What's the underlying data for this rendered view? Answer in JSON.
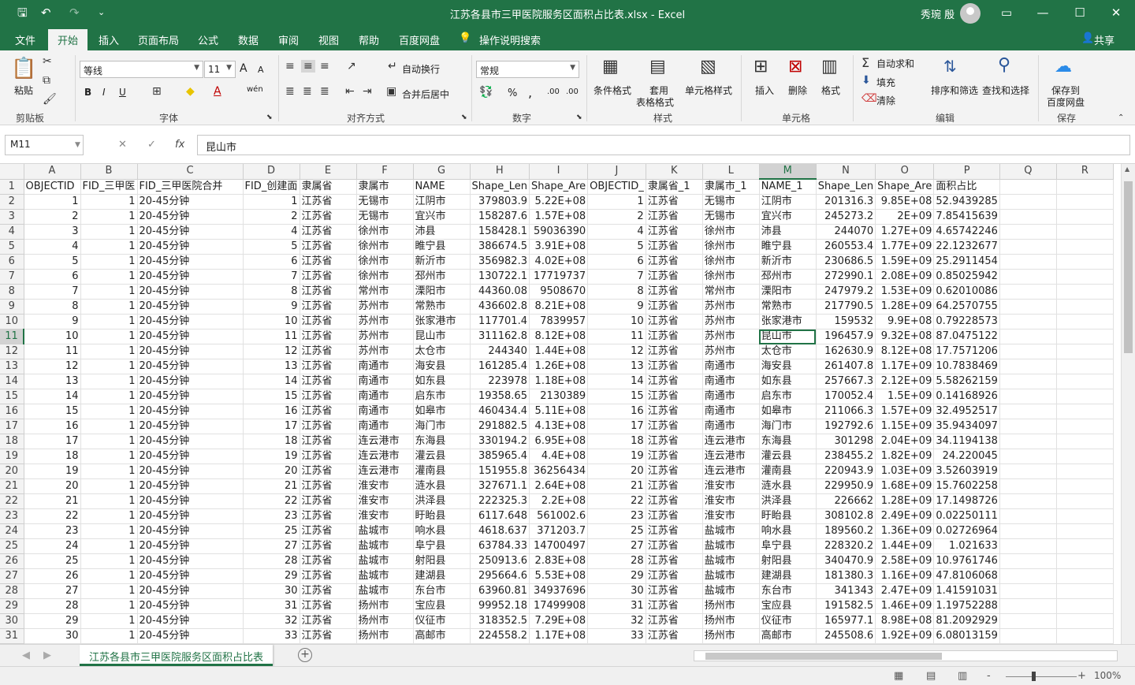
{
  "window": {
    "title": "江苏各县市三甲医院服务区面积占比表.xlsx  -  Excel",
    "user": "秀琬 殷"
  },
  "quick_access": {
    "save": "🖫",
    "undo": "↶",
    "redo": "↷",
    "customize": "⌄"
  },
  "window_buttons": {
    "ribbon_display": "▭",
    "minimize": "—",
    "maximize": "☐",
    "close": "✕"
  },
  "menu": {
    "tabs": [
      "文件",
      "开始",
      "插入",
      "页面布局",
      "公式",
      "数据",
      "审阅",
      "视图",
      "帮助",
      "百度网盘"
    ],
    "active": "开始",
    "tell_me": "操作说明搜索",
    "share": "共享"
  },
  "ribbon": {
    "clipboard": {
      "paste": "粘贴",
      "group": "剪贴板"
    },
    "font": {
      "name": "等线",
      "size": "11",
      "group": "字体",
      "bold": "B",
      "italic": "I",
      "underline": "U",
      "grow": "A",
      "shrink": "A",
      "font_color": "A",
      "phonetic": "wén"
    },
    "alignment": {
      "wrap": "自动换行",
      "merge": "合并后居中",
      "group": "对齐方式"
    },
    "number": {
      "format": "常规",
      "percent": "%",
      "comma": ",",
      "inc_dec": ".00",
      "group": "数字"
    },
    "styles": {
      "conditional": "条件格式",
      "table": "套用",
      "table2": "表格格式",
      "cell": "单元格样式",
      "group": "样式"
    },
    "cells": {
      "insert": "插入",
      "delete": "删除",
      "format": "格式",
      "group": "单元格"
    },
    "editing": {
      "autosum": "自动求和",
      "fill": "填充",
      "clear": "清除",
      "sort": "排序和筛选",
      "find": "查找和选择",
      "group": "编辑"
    },
    "save": {
      "label1": "保存到",
      "label2": "百度网盘",
      "group": "保存"
    }
  },
  "formula_bar": {
    "name_box": "M11",
    "value": "昆山市",
    "cancel": "✕",
    "enter": "✓",
    "fx": "fx"
  },
  "sheet": {
    "columns": [
      "A",
      "B",
      "C",
      "D",
      "E",
      "F",
      "G",
      "H",
      "I",
      "J",
      "K",
      "L",
      "M",
      "N",
      "O",
      "P",
      "Q",
      "R"
    ],
    "selected_column": "M",
    "selected_row": "11",
    "rows": [
      [
        "1",
        "OBJECTID",
        "FID_三甲医",
        "FID_三甲医院合并",
        "FID_创建面",
        "隶属省",
        "隶属市",
        "NAME",
        "Shape_Len",
        "Shape_Are",
        "OBJECTID_",
        "隶属省_1",
        "隶属市_1",
        "NAME_1",
        "Shape_Len",
        "Shape_Are",
        "面积占比",
        "",
        ""
      ],
      [
        "2",
        "1",
        "1",
        "20-45分钟",
        "1",
        "江苏省",
        "无锡市",
        "江阴市",
        "379803.9",
        "5.22E+08",
        "1",
        "江苏省",
        "无锡市",
        "江阴市",
        "201316.3",
        "9.85E+08",
        "52.9439285",
        "",
        ""
      ],
      [
        "3",
        "2",
        "1",
        "20-45分钟",
        "2",
        "江苏省",
        "无锡市",
        "宜兴市",
        "158287.6",
        "1.57E+08",
        "2",
        "江苏省",
        "无锡市",
        "宜兴市",
        "245273.2",
        "2E+09",
        "7.85415639",
        "",
        ""
      ],
      [
        "4",
        "3",
        "1",
        "20-45分钟",
        "4",
        "江苏省",
        "徐州市",
        "沛县",
        "158428.1",
        "59036390",
        "4",
        "江苏省",
        "徐州市",
        "沛县",
        "244070",
        "1.27E+09",
        "4.65742246",
        "",
        ""
      ],
      [
        "5",
        "4",
        "1",
        "20-45分钟",
        "5",
        "江苏省",
        "徐州市",
        "睢宁县",
        "386674.5",
        "3.91E+08",
        "5",
        "江苏省",
        "徐州市",
        "睢宁县",
        "260553.4",
        "1.77E+09",
        "22.1232677",
        "",
        ""
      ],
      [
        "6",
        "5",
        "1",
        "20-45分钟",
        "6",
        "江苏省",
        "徐州市",
        "新沂市",
        "356982.3",
        "4.02E+08",
        "6",
        "江苏省",
        "徐州市",
        "新沂市",
        "230686.5",
        "1.59E+09",
        "25.2911454",
        "",
        ""
      ],
      [
        "7",
        "6",
        "1",
        "20-45分钟",
        "7",
        "江苏省",
        "徐州市",
        "邳州市",
        "130722.1",
        "17719737",
        "7",
        "江苏省",
        "徐州市",
        "邳州市",
        "272990.1",
        "2.08E+09",
        "0.85025942",
        "",
        ""
      ],
      [
        "8",
        "7",
        "1",
        "20-45分钟",
        "8",
        "江苏省",
        "常州市",
        "溧阳市",
        "44360.08",
        "9508670",
        "8",
        "江苏省",
        "常州市",
        "溧阳市",
        "247979.2",
        "1.53E+09",
        "0.62010086",
        "",
        ""
      ],
      [
        "9",
        "8",
        "1",
        "20-45分钟",
        "9",
        "江苏省",
        "苏州市",
        "常熟市",
        "436602.8",
        "8.21E+08",
        "9",
        "江苏省",
        "苏州市",
        "常熟市",
        "217790.5",
        "1.28E+09",
        "64.2570755",
        "",
        ""
      ],
      [
        "10",
        "9",
        "1",
        "20-45分钟",
        "10",
        "江苏省",
        "苏州市",
        "张家港市",
        "117701.4",
        "7839957",
        "10",
        "江苏省",
        "苏州市",
        "张家港市",
        "159532",
        "9.9E+08",
        "0.79228573",
        "",
        ""
      ],
      [
        "11",
        "10",
        "1",
        "20-45分钟",
        "11",
        "江苏省",
        "苏州市",
        "昆山市",
        "311162.8",
        "8.12E+08",
        "11",
        "江苏省",
        "苏州市",
        "昆山市",
        "196457.9",
        "9.32E+08",
        "87.0475122",
        "",
        ""
      ],
      [
        "12",
        "11",
        "1",
        "20-45分钟",
        "12",
        "江苏省",
        "苏州市",
        "太仓市",
        "244340",
        "1.44E+08",
        "12",
        "江苏省",
        "苏州市",
        "太仓市",
        "162630.9",
        "8.12E+08",
        "17.7571206",
        "",
        ""
      ],
      [
        "13",
        "12",
        "1",
        "20-45分钟",
        "13",
        "江苏省",
        "南通市",
        "海安县",
        "161285.4",
        "1.26E+08",
        "13",
        "江苏省",
        "南通市",
        "海安县",
        "261407.8",
        "1.17E+09",
        "10.7838469",
        "",
        ""
      ],
      [
        "14",
        "13",
        "1",
        "20-45分钟",
        "14",
        "江苏省",
        "南通市",
        "如东县",
        "223978",
        "1.18E+08",
        "14",
        "江苏省",
        "南通市",
        "如东县",
        "257667.3",
        "2.12E+09",
        "5.58262159",
        "",
        ""
      ],
      [
        "15",
        "14",
        "1",
        "20-45分钟",
        "15",
        "江苏省",
        "南通市",
        "启东市",
        "19358.65",
        "2130389",
        "15",
        "江苏省",
        "南通市",
        "启东市",
        "170052.4",
        "1.5E+09",
        "0.14168926",
        "",
        ""
      ],
      [
        "16",
        "15",
        "1",
        "20-45分钟",
        "16",
        "江苏省",
        "南通市",
        "如皋市",
        "460434.4",
        "5.11E+08",
        "16",
        "江苏省",
        "南通市",
        "如皋市",
        "211066.3",
        "1.57E+09",
        "32.4952517",
        "",
        ""
      ],
      [
        "17",
        "16",
        "1",
        "20-45分钟",
        "17",
        "江苏省",
        "南通市",
        "海门市",
        "291882.5",
        "4.13E+08",
        "17",
        "江苏省",
        "南通市",
        "海门市",
        "192792.6",
        "1.15E+09",
        "35.9434097",
        "",
        ""
      ],
      [
        "18",
        "17",
        "1",
        "20-45分钟",
        "18",
        "江苏省",
        "连云港市",
        "东海县",
        "330194.2",
        "6.95E+08",
        "18",
        "江苏省",
        "连云港市",
        "东海县",
        "301298",
        "2.04E+09",
        "34.1194138",
        "",
        ""
      ],
      [
        "19",
        "18",
        "1",
        "20-45分钟",
        "19",
        "江苏省",
        "连云港市",
        "灌云县",
        "385965.4",
        "4.4E+08",
        "19",
        "江苏省",
        "连云港市",
        "灌云县",
        "238455.2",
        "1.82E+09",
        "24.220045",
        "",
        ""
      ],
      [
        "20",
        "19",
        "1",
        "20-45分钟",
        "20",
        "江苏省",
        "连云港市",
        "灌南县",
        "151955.8",
        "36256434",
        "20",
        "江苏省",
        "连云港市",
        "灌南县",
        "220943.9",
        "1.03E+09",
        "3.52603919",
        "",
        ""
      ],
      [
        "21",
        "20",
        "1",
        "20-45分钟",
        "21",
        "江苏省",
        "淮安市",
        "涟水县",
        "327671.1",
        "2.64E+08",
        "21",
        "江苏省",
        "淮安市",
        "涟水县",
        "229950.9",
        "1.68E+09",
        "15.7602258",
        "",
        ""
      ],
      [
        "22",
        "21",
        "1",
        "20-45分钟",
        "22",
        "江苏省",
        "淮安市",
        "洪泽县",
        "222325.3",
        "2.2E+08",
        "22",
        "江苏省",
        "淮安市",
        "洪泽县",
        "226662",
        "1.28E+09",
        "17.1498726",
        "",
        ""
      ],
      [
        "23",
        "22",
        "1",
        "20-45分钟",
        "23",
        "江苏省",
        "淮安市",
        "盱眙县",
        "6117.648",
        "561002.6",
        "23",
        "江苏省",
        "淮安市",
        "盱眙县",
        "308102.8",
        "2.49E+09",
        "0.02250111",
        "",
        ""
      ],
      [
        "24",
        "23",
        "1",
        "20-45分钟",
        "25",
        "江苏省",
        "盐城市",
        "响水县",
        "4618.637",
        "371203.7",
        "25",
        "江苏省",
        "盐城市",
        "响水县",
        "189560.2",
        "1.36E+09",
        "0.02726964",
        "",
        ""
      ],
      [
        "25",
        "24",
        "1",
        "20-45分钟",
        "27",
        "江苏省",
        "盐城市",
        "阜宁县",
        "63784.33",
        "14700497",
        "27",
        "江苏省",
        "盐城市",
        "阜宁县",
        "228320.2",
        "1.44E+09",
        "1.021633",
        "",
        ""
      ],
      [
        "26",
        "25",
        "1",
        "20-45分钟",
        "28",
        "江苏省",
        "盐城市",
        "射阳县",
        "250913.6",
        "2.83E+08",
        "28",
        "江苏省",
        "盐城市",
        "射阳县",
        "340470.9",
        "2.58E+09",
        "10.9761746",
        "",
        ""
      ],
      [
        "27",
        "26",
        "1",
        "20-45分钟",
        "29",
        "江苏省",
        "盐城市",
        "建湖县",
        "295664.6",
        "5.53E+08",
        "29",
        "江苏省",
        "盐城市",
        "建湖县",
        "181380.3",
        "1.16E+09",
        "47.8106068",
        "",
        ""
      ],
      [
        "28",
        "27",
        "1",
        "20-45分钟",
        "30",
        "江苏省",
        "盐城市",
        "东台市",
        "63960.81",
        "34937696",
        "30",
        "江苏省",
        "盐城市",
        "东台市",
        "341343",
        "2.47E+09",
        "1.41591031",
        "",
        ""
      ],
      [
        "29",
        "28",
        "1",
        "20-45分钟",
        "31",
        "江苏省",
        "扬州市",
        "宝应县",
        "99952.18",
        "17499908",
        "31",
        "江苏省",
        "扬州市",
        "宝应县",
        "191582.5",
        "1.46E+09",
        "1.19752288",
        "",
        ""
      ],
      [
        "30",
        "29",
        "1",
        "20-45分钟",
        "32",
        "江苏省",
        "扬州市",
        "仪征市",
        "318352.5",
        "7.29E+08",
        "32",
        "江苏省",
        "扬州市",
        "仪征市",
        "165977.1",
        "8.98E+08",
        "81.2092929",
        "",
        ""
      ],
      [
        "31",
        "30",
        "1",
        "20-45分钟",
        "33",
        "江苏省",
        "扬州市",
        "高邮市",
        "224558.2",
        "1.17E+08",
        "33",
        "江苏省",
        "扬州市",
        "高邮市",
        "245508.6",
        "1.92E+09",
        "6.08013159",
        "",
        ""
      ]
    ],
    "tab": "江苏各县市三甲医院服务区面积占比表",
    "add_sheet": "+"
  },
  "status": {
    "zoom": "100%",
    "zoom_minus": "-",
    "zoom_plus": "+"
  },
  "colors": {
    "accent": "#217346",
    "ribbon_bg": "#f3f3f3",
    "grid_line": "#e1e1e1"
  }
}
